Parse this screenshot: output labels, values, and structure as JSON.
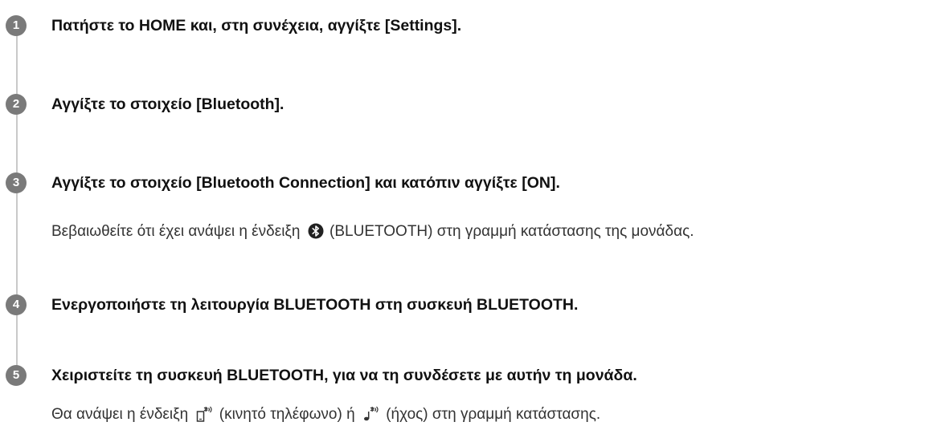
{
  "steps": [
    {
      "number": "1",
      "title": "Πατήστε το HOME και, στη συνέχεια, αγγίξτε [Settings]."
    },
    {
      "number": "2",
      "title": "Αγγίξτε το στοιχείο [Bluetooth]."
    },
    {
      "number": "3",
      "title": "Αγγίξτε το στοιχείο [Bluetooth Connection] και κατόπιν αγγίξτε [ON].",
      "desc_before": "Βεβαιωθείτε ότι έχει ανάψει η ένδειξη",
      "desc_icon": "bluetooth-icon",
      "desc_after": "(BLUETOOTH) στη γραμμή κατάστασης της μονάδας."
    },
    {
      "number": "4",
      "title": "Ενεργοποιήστε τη λειτουργία BLUETOOTH στη συσκευή BLUETOOTH."
    },
    {
      "number": "5",
      "title": "Χειριστείτε τη συσκευή BLUETOOTH, για να τη συνδέσετε με αυτήν τη μονάδα.",
      "desc_before": "Θα ανάψει η ένδειξη",
      "desc_icon_1": "mobile-phone-bluetooth-icon",
      "desc_middle": "(κινητό τηλέφωνο) ή",
      "desc_icon_2": "audio-bluetooth-icon",
      "desc_after": "(ήχος) στη γραμμή κατάστασης."
    }
  ],
  "colors": {
    "badge": "#7a7a7a",
    "rail": "#c9c9c9",
    "title": "#111111",
    "body": "#333333"
  }
}
